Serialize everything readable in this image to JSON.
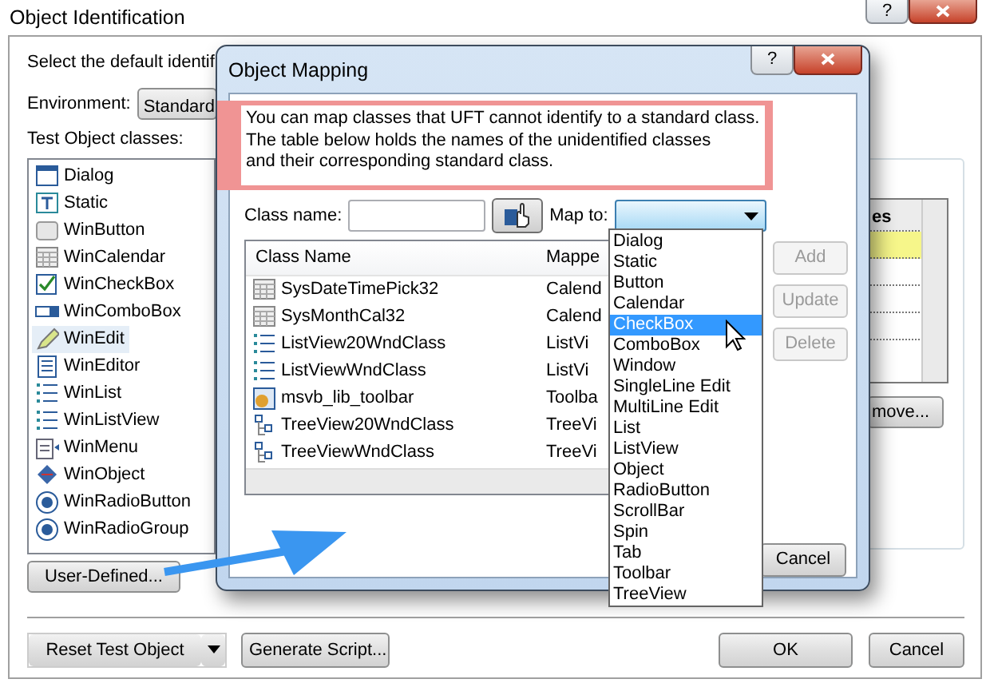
{
  "window": {
    "title": "Object Identification",
    "help_button": "?"
  },
  "prompt": "Select the default identif",
  "environment": {
    "label": "Environment:",
    "value": "Standard"
  },
  "classes_label": "Test Object classes:",
  "classes": [
    {
      "label": "Dialog",
      "kind": "dialog",
      "selected": false
    },
    {
      "label": "Static",
      "kind": "static",
      "selected": false
    },
    {
      "label": "WinButton",
      "kind": "button",
      "selected": false
    },
    {
      "label": "WinCalendar",
      "kind": "calendar",
      "selected": false
    },
    {
      "label": "WinCheckBox",
      "kind": "checkbox",
      "selected": false
    },
    {
      "label": "WinComboBox",
      "kind": "combobox",
      "selected": false
    },
    {
      "label": "WinEdit",
      "kind": "edit",
      "selected": true
    },
    {
      "label": "WinEditor",
      "kind": "editor",
      "selected": false
    },
    {
      "label": "WinList",
      "kind": "list",
      "selected": false
    },
    {
      "label": "WinListView",
      "kind": "list",
      "selected": false
    },
    {
      "label": "WinMenu",
      "kind": "menu",
      "selected": false
    },
    {
      "label": "WinObject",
      "kind": "object",
      "selected": false
    },
    {
      "label": "WinRadioButton",
      "kind": "radio",
      "selected": false
    },
    {
      "label": "WinRadioGroup",
      "kind": "radio",
      "selected": false
    }
  ],
  "user_defined_button": "User-Defined...",
  "properties_panel": {
    "column_header": "es",
    "remove_button": "move..."
  },
  "reset_button": "Reset Test Object",
  "generate_button": "Generate Script...",
  "buttons": [
    "OK",
    "Cancel"
  ],
  "dialog": {
    "title": "Object Mapping",
    "help_button": "?",
    "info": "You can map classes that UFT cannot identify to a standard class.\nThe table below holds the names of the unidentified classes\nand their corresponding standard class.",
    "class_name_label": "Class name:",
    "map_to_label": "Map to:",
    "columns": [
      "Class Name",
      "Mappe"
    ],
    "rows": [
      {
        "class_name": "SysDateTimePick32",
        "mapped": "Calend",
        "kind": "calendar"
      },
      {
        "class_name": "SysMonthCal32",
        "mapped": "Calend",
        "kind": "calendar"
      },
      {
        "class_name": "ListView20WndClass",
        "mapped": "ListVi",
        "kind": "list"
      },
      {
        "class_name": "ListViewWndClass",
        "mapped": "ListVi",
        "kind": "list"
      },
      {
        "class_name": "msvb_lib_toolbar",
        "mapped": "Toolba",
        "kind": "toolbar"
      },
      {
        "class_name": "TreeView20WndClass",
        "mapped": "TreeVi",
        "kind": "tree"
      },
      {
        "class_name": "TreeViewWndClass",
        "mapped": "TreeVi",
        "kind": "tree"
      }
    ],
    "side_buttons": [
      {
        "label": "Add",
        "disabled": true
      },
      {
        "label": "Update",
        "disabled": true
      },
      {
        "label": "Delete",
        "disabled": true
      }
    ],
    "cancel_button": "Cancel",
    "map_to_options": [
      {
        "label": "Dialog",
        "selected": false
      },
      {
        "label": "Static",
        "selected": false
      },
      {
        "label": "Button",
        "selected": false
      },
      {
        "label": "Calendar",
        "selected": false
      },
      {
        "label": "CheckBox",
        "selected": true
      },
      {
        "label": "ComboBox",
        "selected": false
      },
      {
        "label": "Window",
        "selected": false
      },
      {
        "label": "SingleLine Edit",
        "selected": false
      },
      {
        "label": "MultiLine Edit",
        "selected": false
      },
      {
        "label": "List",
        "selected": false
      },
      {
        "label": "ListView",
        "selected": false
      },
      {
        "label": "Object",
        "selected": false
      },
      {
        "label": "RadioButton",
        "selected": false
      },
      {
        "label": "ScrollBar",
        "selected": false
      },
      {
        "label": "Spin",
        "selected": false
      },
      {
        "label": "Tab",
        "selected": false
      },
      {
        "label": "Toolbar",
        "selected": false
      },
      {
        "label": "TreeView",
        "selected": false
      }
    ]
  }
}
